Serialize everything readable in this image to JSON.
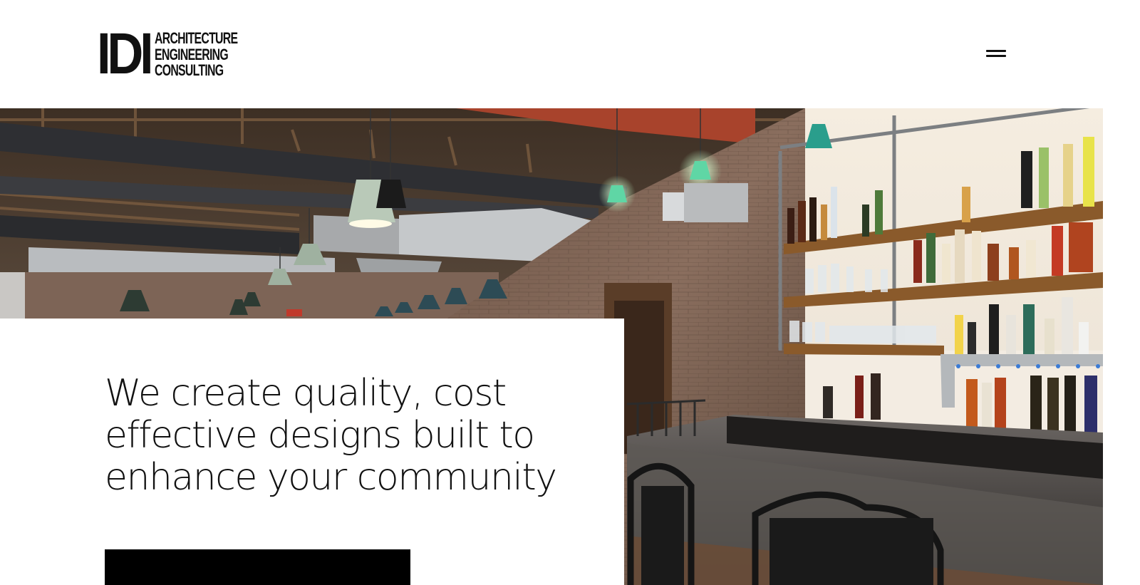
{
  "header": {
    "logo_mark": "IDI",
    "logo_lines": [
      "ARCHITECTURE",
      "ENGINEERING",
      "CONSULTING"
    ],
    "menu_icon": "hamburger-menu-icon"
  },
  "hero": {
    "image_subject": "restaurant-bar-interior-photo"
  },
  "main": {
    "headline": "We create quality, cost effective designs built to enhance your community",
    "cta_label": ""
  },
  "colors": {
    "text": "#111111",
    "background": "#ffffff",
    "cta_background": "#000000"
  }
}
